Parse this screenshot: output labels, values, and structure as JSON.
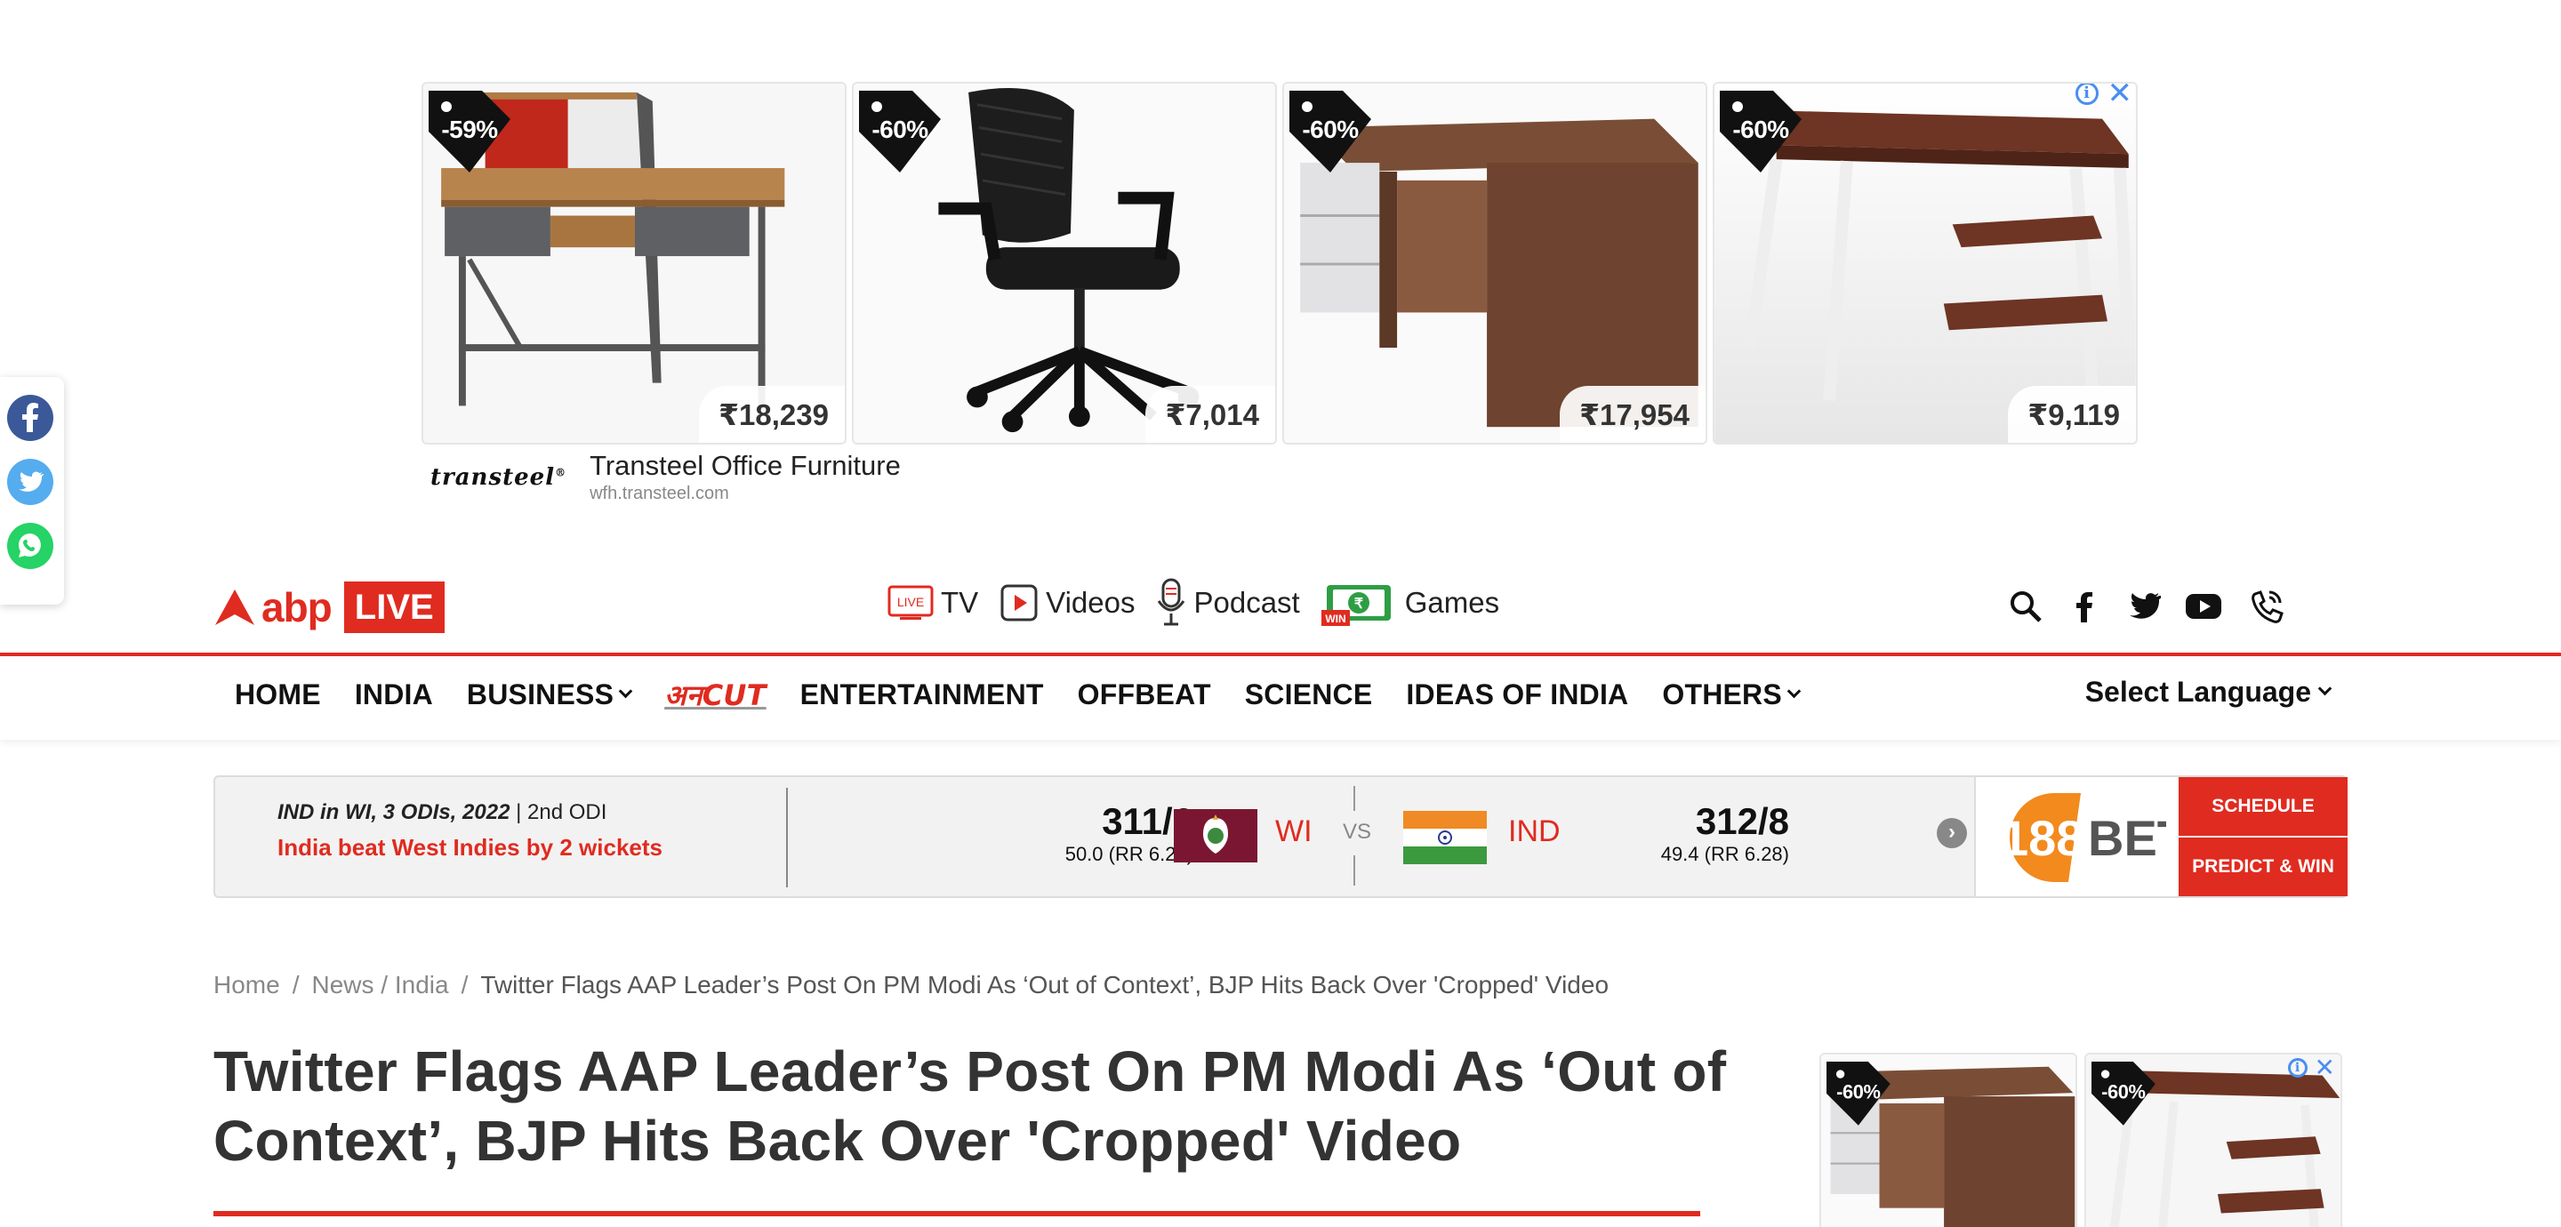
{
  "top_ad": {
    "tiles": [
      {
        "discount": "-59%",
        "price": "₹18,239",
        "product": "study-desk"
      },
      {
        "discount": "-60%",
        "price": "₹7,014",
        "product": "office-chair"
      },
      {
        "discount": "-60%",
        "price": "₹17,954",
        "product": "office-desk"
      },
      {
        "discount": "-60%",
        "price": "₹9,119",
        "product": "shelf-desk"
      }
    ],
    "brand_logo": "transteel",
    "brand_name": "Transteel Office Furniture",
    "brand_url": "wfh.transteel.com",
    "adchoices_info": "i",
    "adchoices_close": "✕"
  },
  "share": {
    "items": [
      "facebook-icon",
      "twitter-icon",
      "whatsapp-icon"
    ],
    "colors": {
      "facebook": "#3b5998",
      "twitter": "#55acee",
      "whatsapp": "#25d366"
    }
  },
  "header": {
    "logo_text": "abp",
    "logo_badge": "LIVE",
    "mid_nav": [
      {
        "label": "TV",
        "icon": "live-tv-icon",
        "icon_text": "LIVE"
      },
      {
        "label": "Videos",
        "icon": "play-icon"
      },
      {
        "label": "Podcast",
        "icon": "microphone-icon"
      },
      {
        "label": "Games",
        "icon": "games-icon",
        "icon_text": "WIN"
      }
    ],
    "right_icons": [
      "search-icon",
      "facebook-icon",
      "twitter-icon",
      "youtube-icon",
      "phone-icon"
    ]
  },
  "nav": {
    "items": [
      {
        "label": "HOME",
        "dropdown": false
      },
      {
        "label": "INDIA",
        "dropdown": false
      },
      {
        "label": "BUSINESS",
        "dropdown": true
      },
      {
        "label": "अनCUT",
        "dropdown": false
      },
      {
        "label": "ENTERTAINMENT",
        "dropdown": false
      },
      {
        "label": "OFFBEAT",
        "dropdown": false
      },
      {
        "label": "SCIENCE",
        "dropdown": false
      },
      {
        "label": "IDEAS OF INDIA",
        "dropdown": false
      },
      {
        "label": "OTHERS",
        "dropdown": true
      }
    ],
    "language": "Select Language"
  },
  "score": {
    "series": "IND in WI, 3 ODIs, 2022",
    "separator": "|",
    "match": "2nd ODI",
    "result": "India beat West Indies by 2 wickets",
    "team1": {
      "name": "WI",
      "runs": "311/6",
      "overs": "50.0 (RR 6.22)"
    },
    "vs": "VS",
    "team2": {
      "name": "IND",
      "runs": "312/8",
      "overs": "49.4 (RR 6.28)"
    },
    "sponsor_a": "188",
    "sponsor_b": "BET",
    "btn_schedule": "SCHEDULE",
    "btn_predict": "PREDICT & WIN",
    "accent": "#e02b20"
  },
  "breadcrumb": {
    "home": "Home",
    "sep1": "/",
    "news": "News / India",
    "sep2": "/",
    "current": "Twitter Flags AAP Leader’s Post On PM Modi As ‘Out of Context’, BJP Hits Back Over 'Cropped' Video"
  },
  "article": {
    "headline": "Twitter Flags AAP Leader’s Post On PM Modi As ‘Out of Context’, BJP Hits Back Over 'Cropped' Video"
  },
  "side_ad": {
    "tiles": [
      {
        "discount": "-60%",
        "product": "office-desk"
      },
      {
        "discount": "-60%",
        "product": "shelf-desk"
      }
    ],
    "adchoices_info": "i",
    "adchoices_close": "✕"
  }
}
